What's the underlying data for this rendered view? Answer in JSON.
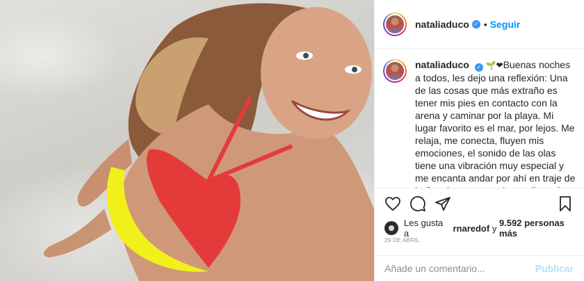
{
  "header": {
    "username": "nataliaduco",
    "separator": "•",
    "follow_label": "Seguir"
  },
  "caption": {
    "username": "nataliaduco",
    "emojis": "🌱❤",
    "text": "Buenas noches a todos, les dejo una reflexión: Una de las cosas que más extraño es tener mis pies en contacto con la arena y caminar por la playa. Mi lugar favorito es el mar, por lejos. Me relaja, me conecta, fluyen mis emociones, el sonido de las olas tiene una vibración muy especial y me encanta andar por ahí en traje de baño, sin preocupaciones, llena de arena y"
  },
  "actions": {
    "like_icon": "heart-icon",
    "comment_icon": "comment-icon",
    "share_icon": "paper-plane-icon",
    "save_icon": "bookmark-icon"
  },
  "likes": {
    "prefix": "Les gusta a",
    "user": "rnaredof",
    "joiner": "y",
    "count": "9.592 personas más"
  },
  "date": "29 DE ABRIL",
  "comment": {
    "placeholder": "Añade un comentario...",
    "publish_label": "Publicar"
  },
  "colors": {
    "accent": "#0095f6",
    "publish_disabled": "#b2dffc",
    "muted": "#8e8e8e",
    "text": "#262626",
    "verified": "#3897f0"
  }
}
